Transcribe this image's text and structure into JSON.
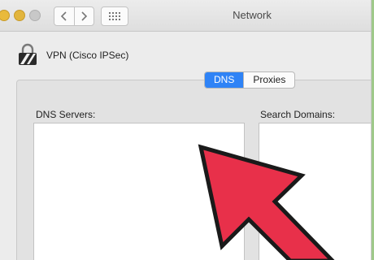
{
  "window": {
    "title": "Network"
  },
  "toolbar": {
    "back_icon": "chevron-left-icon",
    "forward_icon": "chevron-right-icon",
    "show_all_icon": "grid-icon"
  },
  "vpn": {
    "icon": "lock-icon",
    "name": "VPN (Cisco IPSec)"
  },
  "tabs": [
    {
      "label": "DNS",
      "active": true
    },
    {
      "label": "Proxies",
      "active": false
    }
  ],
  "dns": {
    "label": "DNS Servers:",
    "entries": []
  },
  "search": {
    "label": "Search Domains:",
    "entries": []
  },
  "colors": {
    "accent": "#2f83f6",
    "pointer_arrow": "#e8304a",
    "background": "#9fc98a"
  }
}
